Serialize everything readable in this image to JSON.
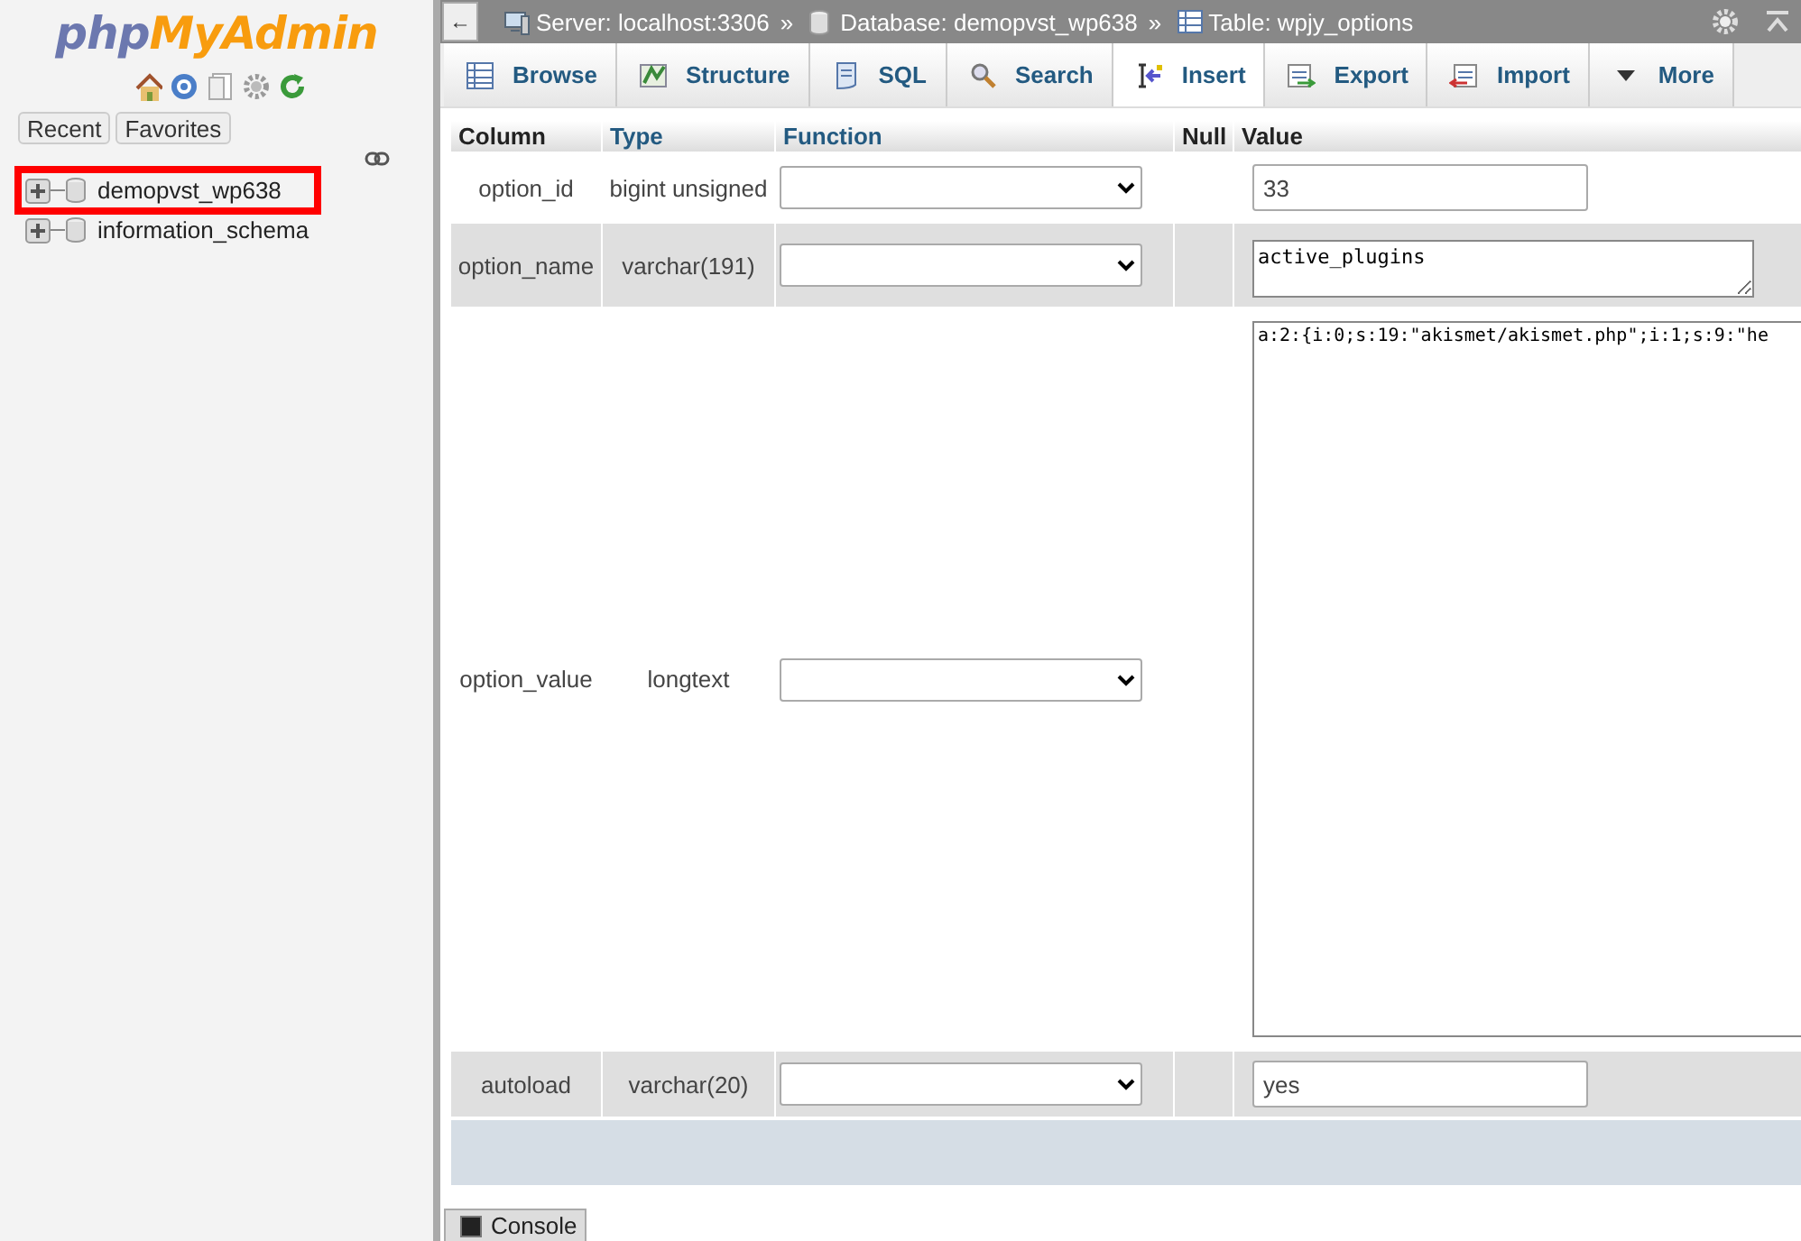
{
  "logo": {
    "first": "php",
    "second": "MyAdmin"
  },
  "sidebar": {
    "buttons": [
      "Recent",
      "Favorites"
    ],
    "tree": [
      {
        "label": "demopvst_wp638",
        "highlighted": true
      },
      {
        "label": "information_schema",
        "highlighted": false
      }
    ]
  },
  "breadcrumb": {
    "separator": "»",
    "items": [
      {
        "kind": "server",
        "label": "Server: localhost:3306"
      },
      {
        "kind": "database",
        "label": "Database: demopvst_wp638"
      },
      {
        "kind": "table",
        "label": "Table: wpjy_options"
      }
    ]
  },
  "back_button": "←",
  "tabs": [
    {
      "kind": "browse",
      "label": "Browse",
      "selected": false
    },
    {
      "kind": "structure",
      "label": "Structure",
      "selected": false
    },
    {
      "kind": "sql",
      "label": "SQL",
      "selected": false
    },
    {
      "kind": "search",
      "label": "Search",
      "selected": false
    },
    {
      "kind": "insert",
      "label": "Insert",
      "selected": true
    },
    {
      "kind": "export",
      "label": "Export",
      "selected": false
    },
    {
      "kind": "import",
      "label": "Import",
      "selected": false
    },
    {
      "kind": "more",
      "label": "More",
      "selected": false
    }
  ],
  "table": {
    "columns": [
      "Column",
      "Type",
      "Function",
      "Null",
      "Value"
    ],
    "rows": [
      {
        "column": "option_id",
        "type": "bigint unsigned",
        "kind": "input",
        "value": "33"
      },
      {
        "column": "option_name",
        "type": "varchar(191)",
        "kind": "textarea",
        "value": "active_plugins"
      },
      {
        "column": "option_value",
        "type": "longtext",
        "kind": "largetext",
        "value": "a:2:{i:0;s:19:\"akismet/akismet.php\";i:1;s:9:\"he"
      },
      {
        "column": "autoload",
        "type": "varchar(20)",
        "kind": "input",
        "value": "yes"
      }
    ]
  },
  "console": "Console"
}
